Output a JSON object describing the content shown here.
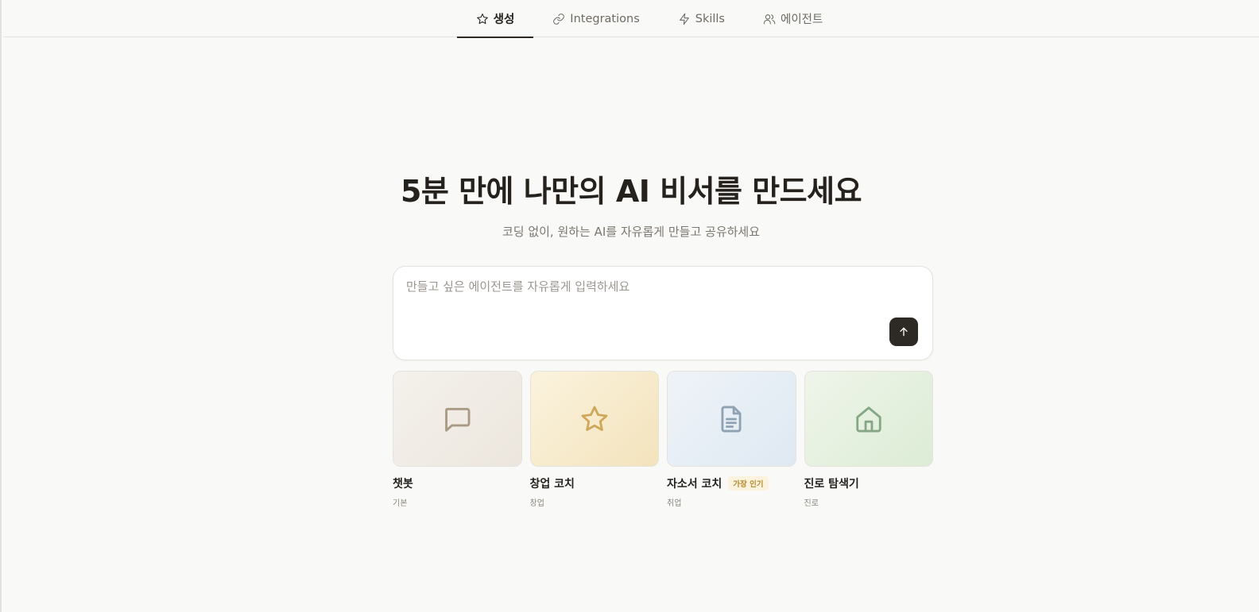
{
  "nav": {
    "tabs": [
      {
        "label": "생성",
        "icon": "star-icon",
        "active": true
      },
      {
        "label": "Integrations",
        "icon": "link-icon",
        "active": false
      },
      {
        "label": "Skills",
        "icon": "bolt-icon",
        "active": false
      },
      {
        "label": "에이전트",
        "icon": "users-icon",
        "active": false
      }
    ]
  },
  "hero": {
    "title": "5분 만에 나만의 AI 비서를 만드세요",
    "subtitle": "코딩 없이, 원하는 AI를 자유롭게 만들고 공유하세요"
  },
  "prompt": {
    "value": "",
    "placeholder": "만들고 싶은 에이전트를 자유롭게 입력하세요",
    "send_icon": "arrow-up-icon"
  },
  "templates": [
    {
      "title": "챗봇",
      "subtitle": "기본",
      "icon": "chat-bubble-icon",
      "badge": ""
    },
    {
      "title": "창업 코치",
      "subtitle": "창업",
      "icon": "star-icon",
      "badge": ""
    },
    {
      "title": "자소서 코치",
      "subtitle": "취업",
      "icon": "document-icon",
      "badge": "가장 인기"
    },
    {
      "title": "진로 탐색기",
      "subtitle": "진로",
      "icon": "home-icon",
      "badge": ""
    }
  ],
  "colors": {
    "accent": "#2d2924",
    "background": "#f9f9f7",
    "badge_text": "#b5892c",
    "badge_bg": "#fbf3dd"
  }
}
